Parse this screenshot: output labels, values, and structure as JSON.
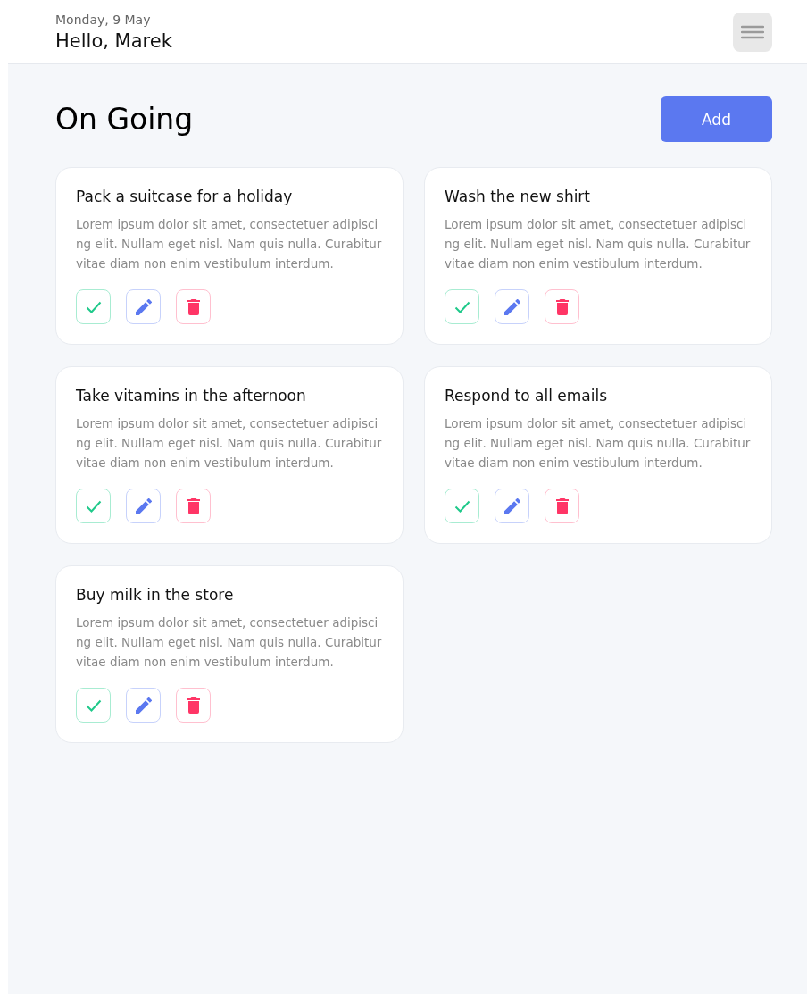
{
  "header": {
    "date": "Monday, 9 May",
    "greeting": "Hello, Marek"
  },
  "section": {
    "title": "On Going",
    "add_button": "Add"
  },
  "tasks": [
    {
      "title": "Pack a suitcase for a holiday",
      "description": "Lorem ipsum dolor sit amet, consectetuer adipiscing elit. Nullam eget nisl. Nam quis nulla. Curabitur vitae diam non enim vestibulum interdum."
    },
    {
      "title": "Wash the new shirt",
      "description": "Lorem ipsum dolor sit amet, consectetuer adipiscing elit. Nullam eget nisl. Nam quis nulla. Curabitur vitae diam non enim vestibulum interdum."
    },
    {
      "title": "Take vitamins in the afternoon",
      "description": "Lorem ipsum dolor sit amet, consectetuer adipiscing elit. Nullam eget nisl. Nam quis nulla. Curabitur vitae diam non enim vestibulum interdum."
    },
    {
      "title": "Respond to all emails",
      "description": "Lorem ipsum dolor sit amet, consectetuer adipiscing elit. Nullam eget nisl. Nam quis nulla. Curabitur vitae diam non enim vestibulum interdum."
    },
    {
      "title": "Buy milk in the store",
      "description": "Lorem ipsum dolor sit amet, consectetuer adipiscing elit. Nullam eget nisl. Nam quis nulla. Curabitur vitae diam non enim vestibulum interdum."
    }
  ]
}
